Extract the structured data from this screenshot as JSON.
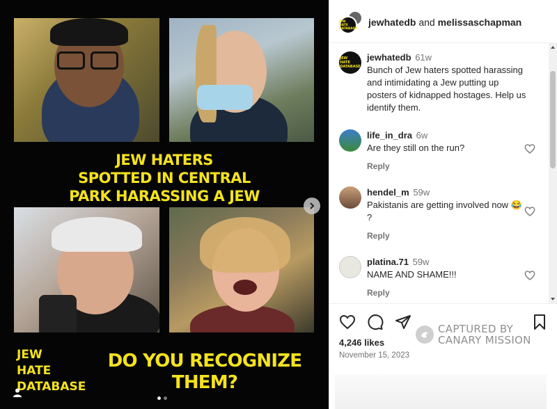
{
  "post": {
    "header_user1": "jewhatedb",
    "header_and": "and",
    "header_user2": "melissaschapman",
    "logo_text": [
      "JEW",
      "HATE",
      "DATABASE"
    ]
  },
  "media": {
    "headline_lines": [
      "JEW HATERS",
      "SPOTTED IN CENTRAL",
      "PARK HARASSING A JEW"
    ],
    "logo_lines": [
      "JEW",
      "HATE",
      "DATABASE"
    ],
    "bottom_lines": [
      "DO YOU RECOGNIZE",
      "THEM?"
    ],
    "accent_color": "#f5e31c",
    "carousel_page": 1,
    "carousel_total": 2
  },
  "caption": {
    "user": "jewhatedb",
    "age": "61w",
    "text": "Bunch of Jew haters spotted harassing and intimidating a Jew putting up posters of kidnapped hostages. Help us identify them."
  },
  "comments": [
    {
      "user": "life_in_dra",
      "age": "6w",
      "text": "Are they still on the run?",
      "reply": "Reply"
    },
    {
      "user": "hendel_m",
      "age": "59w",
      "text": "Pakistanis are getting involved now 😂 ?",
      "reply": "Reply"
    },
    {
      "user": "platina.71",
      "age": "59w",
      "text": "NAME AND SHAME!!!",
      "reply": "Reply"
    }
  ],
  "footer": {
    "likes": "4,246 likes",
    "date": "November 15, 2023",
    "watermark_line1": "CAPTURED BY",
    "watermark_line2": "CANARY MISSION"
  },
  "icons": [
    "heart-icon",
    "comment-icon",
    "share-icon",
    "bookmark-icon",
    "chevron-right-icon",
    "user-tag-icon"
  ]
}
